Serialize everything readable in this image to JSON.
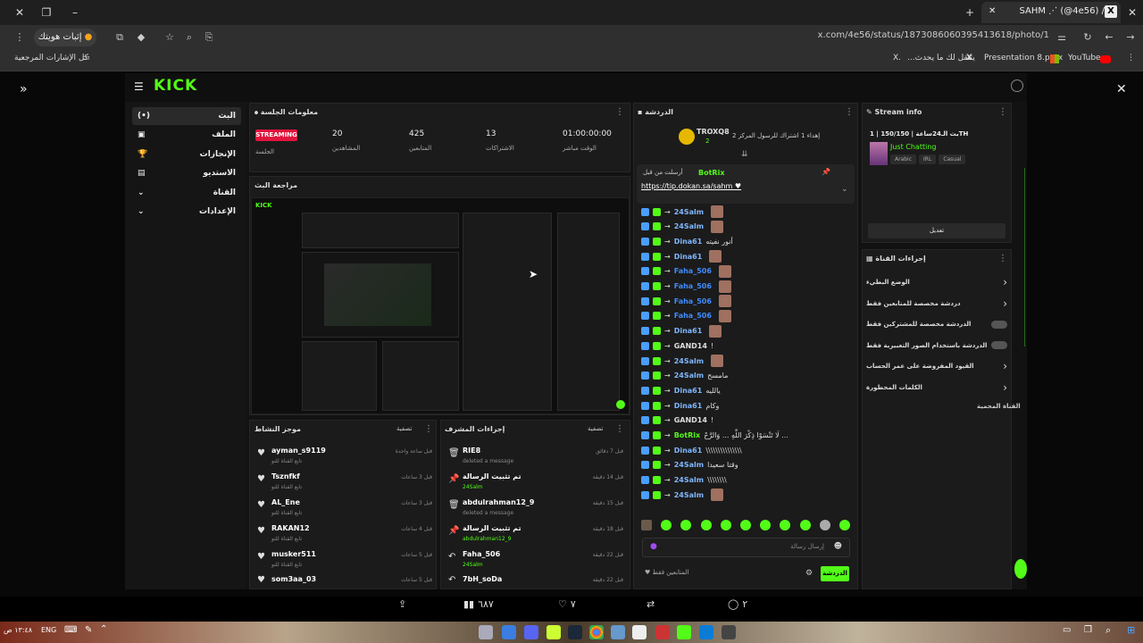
{
  "browser": {
    "tab_title": "SAHM ⋰ (@4e56) / X",
    "tab_logo": "X",
    "url": "x.com/4e56/status/1873086060395413618/photo/1",
    "profile_label": "إثبات هويتك",
    "bookmarks": {
      "all": "كل الإشارات المرجعية",
      "items": [
        "...يتنقل لك ما يحدث",
        "Presentation 8.pptx",
        "YouTube"
      ],
      "x_logo": "X."
    }
  },
  "kick": {
    "logo": "KICK",
    "sidebar": [
      {
        "label": "البث",
        "icon": "(•)"
      },
      {
        "label": "الملف",
        "icon": "▣"
      },
      {
        "label": "الإنجازات",
        "icon": "🏆"
      },
      {
        "label": "الاستديو",
        "icon": "▤"
      },
      {
        "label": "القناة",
        "icon": "⚙"
      },
      {
        "label": "الإعدادات",
        "icon": "⚙"
      }
    ],
    "session": {
      "title": "معلومات الجلسة",
      "status": "STREAMING",
      "status_label": "الجلسة",
      "stats": [
        {
          "value": "20",
          "label": "المشاهدين"
        },
        {
          "value": "425",
          "label": "المتابعين"
        },
        {
          "value": "13",
          "label": "الاشتراكات"
        },
        {
          "value": "01:00:00:00",
          "label": "الوقت مباشر"
        }
      ]
    },
    "preview_title": "مراجعة البث",
    "activity": {
      "title": "موجز النشاط",
      "filter": "تصفية",
      "items": [
        {
          "name": "ayman_s9119",
          "sub": "تابع القناة للتو",
          "time": "قبل ساعة واحدة"
        },
        {
          "name": "Tsznfkf",
          "sub": "تابع القناة للتو",
          "time": "قبل 3 ساعات"
        },
        {
          "name": "AL_Ene",
          "sub": "تابع القناة للتو",
          "time": "قبل 3 ساعات"
        },
        {
          "name": "RAKAN12",
          "sub": "تابع القناة للتو",
          "time": "قبل 4 ساعات"
        },
        {
          "name": "musker511",
          "sub": "تابع القناة للتو",
          "time": "قبل 5 ساعات"
        },
        {
          "name": "som3aa_03",
          "sub": "",
          "time": "قبل 5 ساعات"
        }
      ]
    },
    "modactions": {
      "title": "إجراءات المشرف",
      "filter": "تصفية",
      "items": [
        {
          "icon": "trash-icon",
          "name": "RIE8",
          "sub": "deleted a message",
          "time": "قبل 7 دقائق"
        },
        {
          "icon": "pin-icon",
          "name": "تم تثبيت الرسالة",
          "sub": "24Salm",
          "time": "قبل 14 دقيقة"
        },
        {
          "icon": "trash-icon",
          "name": "abdulrahman12_9",
          "sub": "deleted a message",
          "time": "قبل 15 دقيقة"
        },
        {
          "icon": "pin-icon",
          "name": "تم تثبيت الرسالة",
          "sub": "abdulrahman12_9",
          "time": "قبل 18 دقيقة"
        },
        {
          "icon": "undo-icon",
          "name": "Faha_506",
          "sub": "24Salm",
          "time": "قبل 22 دقيقة"
        },
        {
          "icon": "undo-icon",
          "name": "7bH_soDa",
          "sub": "",
          "time": "قبل 22 دقيقة"
        }
      ]
    },
    "chat": {
      "title": "الدردشة",
      "top_user": "TROXQ8",
      "top_count": "2",
      "top_text": "إهداء 1 اشتراك للرسول المركز 2",
      "pinned_user": "BotRix",
      "pinned_by": "أرسلت من قبل",
      "pinned_link": "https://tip.dokan.sa/sahm ♥",
      "lines": [
        {
          "user": "24Salm",
          "text": "",
          "color": "#7fb6ff"
        },
        {
          "user": "24Salm",
          "text": "",
          "color": "#7fb6ff"
        },
        {
          "user": "Dina61",
          "text": "أنور نفيته",
          "color": "#7fb6ff"
        },
        {
          "user": "Dina61",
          "text": "",
          "color": "#7fb6ff"
        },
        {
          "user": "Faha_506",
          "text": "",
          "color": "#3f8cff"
        },
        {
          "user": "Faha_506",
          "text": "",
          "color": "#3f8cff"
        },
        {
          "user": "Faha_506",
          "text": "",
          "color": "#3f8cff"
        },
        {
          "user": "Faha_506",
          "text": "",
          "color": "#3f8cff"
        },
        {
          "user": "Dina61",
          "text": "",
          "color": "#7fb6ff"
        },
        {
          "user": "GAND14",
          "text": "!",
          "color": "#ddd"
        },
        {
          "user": "24Salm",
          "text": "",
          "color": "#7fb6ff"
        },
        {
          "user": "24Salm",
          "text": "مامسح",
          "color": "#7fb6ff"
        },
        {
          "user": "Dina61",
          "text": "يالليه",
          "color": "#7fb6ff"
        },
        {
          "user": "Dina61",
          "text": "وكام",
          "color": "#7fb6ff"
        },
        {
          "user": "GAND14",
          "text": "!",
          "color": "#ddd"
        },
        {
          "user": "BotRix",
          "text": "لَا تَنْسَوْا ذِكْرَ اللَّهِ ... وَالرَّحْ ...",
          "color": "#53fc18"
        },
        {
          "user": "Dina61",
          "text": "\\\\\\\\\\\\\\\\\\\\\\\\\\\\\\",
          "color": "#7fb6ff"
        },
        {
          "user": "24Salm",
          "text": "وقتا سعيدا",
          "color": "#7fb6ff"
        },
        {
          "user": "24Salm",
          "text": "\\\\\\\\\\\\\\\\",
          "color": "#7fb6ff"
        },
        {
          "user": "24Salm",
          "text": "",
          "color": "#7fb6ff"
        }
      ],
      "input_placeholder": "إرسال رسالة",
      "followers_only": "المتابعين فقط",
      "send_button": "الدردشة"
    },
    "streaminfo": {
      "title": "Stream info",
      "name": "بث الـ24ساعة | 150/150 | 1TH",
      "category": "Just Chatting",
      "tags": [
        "Arabic",
        "IRL",
        "Casual"
      ],
      "edit_button": "تعديل"
    },
    "channel_actions": {
      "title": "إجراءات القناة",
      "items": [
        {
          "label": "الوضع البطيء",
          "type": "arrow"
        },
        {
          "label": "دردشة مخصصة للمتابعين فقط",
          "type": "arrow"
        },
        {
          "label": "الدردشة مخصصة للمشتركين فقط",
          "type": "toggle"
        },
        {
          "label": "الدردشة باستخدام الصور التعبيرية فقط",
          "type": "toggle"
        },
        {
          "label": "القيود المفروضة على عمر الحساب",
          "type": "arrow"
        },
        {
          "label": "الكلمات المحظورة",
          "type": "arrow"
        }
      ],
      "footer": "القناة المحمية"
    }
  },
  "twitter_bar": {
    "views": "٦٨٧",
    "likes": "٧",
    "replies": "٢"
  },
  "taskbar": {
    "time": "١٣:٤٨ ص",
    "lang": "ENG"
  }
}
